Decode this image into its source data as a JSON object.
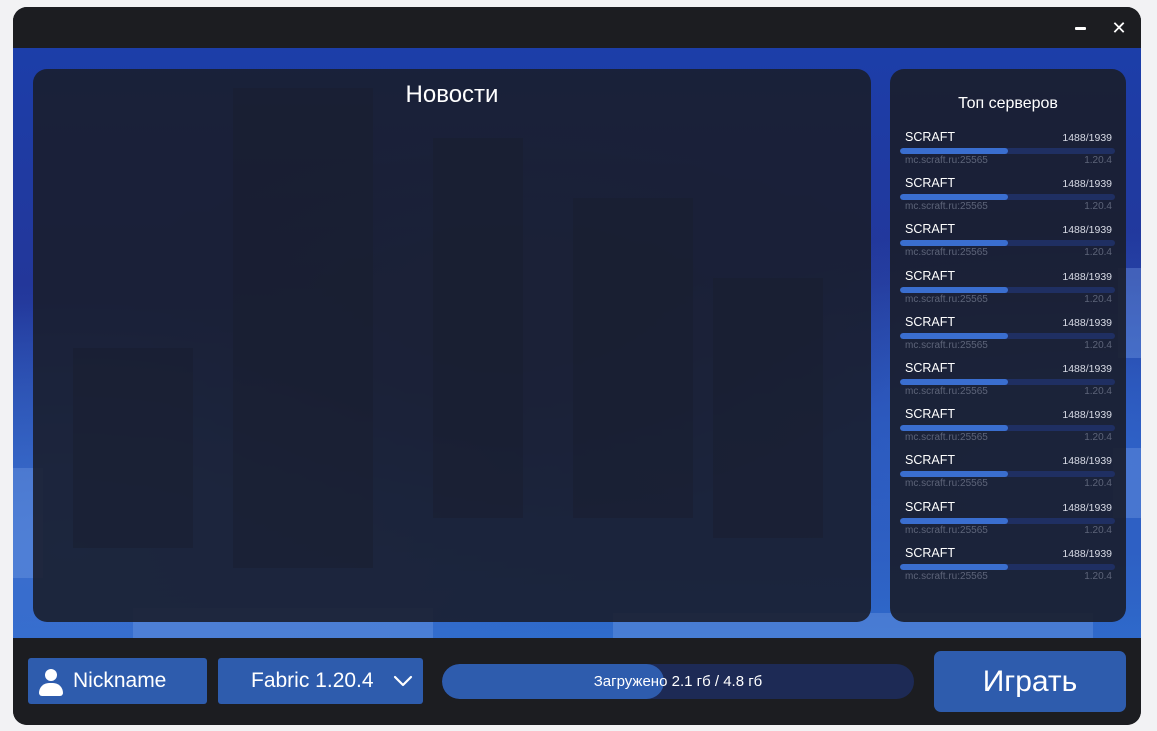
{
  "window": {
    "minimize_icon": "minimize-icon",
    "close_icon": "close-icon",
    "close_glyph": "✕"
  },
  "news": {
    "title": "Новости"
  },
  "servers": {
    "title": "Топ серверов",
    "items": [
      {
        "name": "SCRAFT",
        "players": "1488/1939",
        "address": "mc.scraft.ru:25565",
        "version": "1.20.4",
        "load_fraction": 0.5
      },
      {
        "name": "SCRAFT",
        "players": "1488/1939",
        "address": "mc.scraft.ru:25565",
        "version": "1.20.4",
        "load_fraction": 0.5
      },
      {
        "name": "SCRAFT",
        "players": "1488/1939",
        "address": "mc.scraft.ru:25565",
        "version": "1.20.4",
        "load_fraction": 0.5
      },
      {
        "name": "SCRAFT",
        "players": "1488/1939",
        "address": "mc.scraft.ru:25565",
        "version": "1.20.4",
        "load_fraction": 0.5
      },
      {
        "name": "SCRAFT",
        "players": "1488/1939",
        "address": "mc.scraft.ru:25565",
        "version": "1.20.4",
        "load_fraction": 0.5
      },
      {
        "name": "SCRAFT",
        "players": "1488/1939",
        "address": "mc.scraft.ru:25565",
        "version": "1.20.4",
        "load_fraction": 0.5
      },
      {
        "name": "SCRAFT",
        "players": "1488/1939",
        "address": "mc.scraft.ru:25565",
        "version": "1.20.4",
        "load_fraction": 0.5
      },
      {
        "name": "SCRAFT",
        "players": "1488/1939",
        "address": "mc.scraft.ru:25565",
        "version": "1.20.4",
        "load_fraction": 0.5
      },
      {
        "name": "SCRAFT",
        "players": "1488/1939",
        "address": "mc.scraft.ru:25565",
        "version": "1.20.4",
        "load_fraction": 0.5
      },
      {
        "name": "SCRAFT",
        "players": "1488/1939",
        "address": "mc.scraft.ru:25565",
        "version": "1.20.4",
        "load_fraction": 0.5
      }
    ]
  },
  "footer": {
    "nickname": "Nickname",
    "user_icon": "user-icon",
    "version_selected": "Fabric 1.20.4",
    "dropdown_icon": "chevron-down-icon",
    "download_text": "Загружено 2.1 гб / 4.8 гб",
    "download_fraction": 0.47,
    "play_label": "Играть"
  },
  "colors": {
    "accent": "#2e5cad",
    "panel": "#1a1e2e",
    "titlebar": "#1c1d21",
    "progress_track": "#1d2a55"
  }
}
